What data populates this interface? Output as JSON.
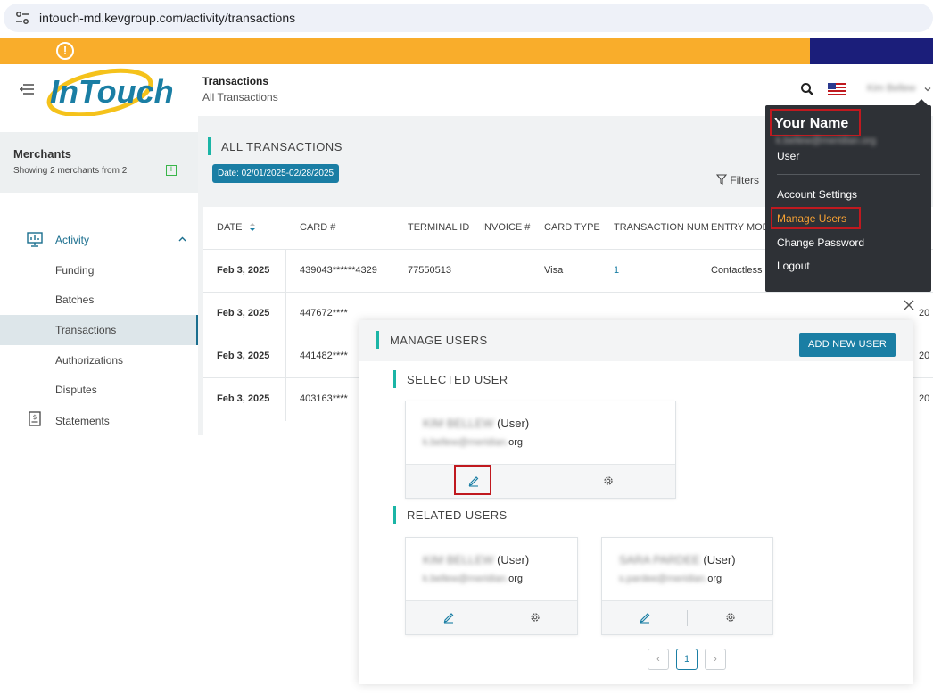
{
  "browser": {
    "url": "intouch-md.kevgroup.com/activity/transactions"
  },
  "banner": {
    "icon": "warning-icon"
  },
  "header": {
    "logo_text": "InTouch",
    "breadcrumb_title": "Transactions",
    "breadcrumb_sub": "All Transactions",
    "user_name_blurred": "Kim Bellew"
  },
  "sidebar": {
    "merchants_title": "Merchants",
    "merchants_sub": "Showing 2 merchants from 2",
    "activity_label": "Activity",
    "sub_items": [
      "Funding",
      "Batches",
      "Transactions",
      "Authorizations",
      "Disputes"
    ],
    "active_item": "Transactions",
    "statements_label": "Statements"
  },
  "main": {
    "section_title": "ALL TRANSACTIONS",
    "date_chip": "Date: 02/01/2025-02/28/2025",
    "filters_label": "Filters"
  },
  "table": {
    "headers": [
      "DATE",
      "CARD #",
      "TERMINAL ID",
      "INVOICE #",
      "CARD TYPE",
      "TRANSACTION NUM",
      "ENTRY MOD"
    ],
    "rows": [
      {
        "date": "Feb 3, 2025",
        "card": "439043******4329",
        "terminal": "77550513",
        "invoice": "",
        "card_type": "Visa",
        "txn": "1",
        "entry": "Contactless",
        "trunc": ""
      },
      {
        "date": "Feb 3, 2025",
        "card": "447672****",
        "terminal": "",
        "invoice": "",
        "card_type": "",
        "txn": "",
        "entry": "",
        "trunc": "20"
      },
      {
        "date": "Feb 3, 2025",
        "card": "441482****",
        "terminal": "",
        "invoice": "",
        "card_type": "",
        "txn": "",
        "entry": "",
        "trunc": "20"
      },
      {
        "date": "Feb 3, 2025",
        "card": "403163****",
        "terminal": "",
        "invoice": "",
        "card_type": "",
        "txn": "",
        "entry": "",
        "trunc": "20"
      }
    ]
  },
  "dropdown": {
    "name": "Your Name",
    "email_blurred": "k.bellew@meridian.org",
    "role": "User",
    "account_settings": "Account Settings",
    "manage_users": "Manage Users",
    "change_password": "Change Password",
    "logout": "Logout"
  },
  "modal": {
    "title": "MANAGE USERS",
    "add_button": "ADD NEW USER",
    "selected_title": "SELECTED USER",
    "related_title": "RELATED USERS",
    "selected_user": {
      "name_blurred": "KIM BELLEW",
      "role": "(User)",
      "email_blurred": "k.bellew@meridian.",
      "email_suffix": "org"
    },
    "related_users": [
      {
        "name_blurred": "KIM BELLEW",
        "role": "(User)",
        "email_blurred": "k.bellew@meridian.",
        "email_suffix": "org"
      },
      {
        "name_blurred": "SARA PARDEE",
        "role": "(User)",
        "email_blurred": "s.pardee@meridian.",
        "email_suffix": "org"
      }
    ],
    "pagination": {
      "prev": "‹",
      "current": "1",
      "next": "›"
    }
  },
  "colors": {
    "banner": "#f9ad2b",
    "banner_dark": "#1b1e7a",
    "accent": "#1a7ea4",
    "teal_bar": "#1bb5a6",
    "highlight_red": "#c0191f",
    "dropdown_bg": "#2e3136",
    "manage_users_orange": "#f7a133"
  }
}
